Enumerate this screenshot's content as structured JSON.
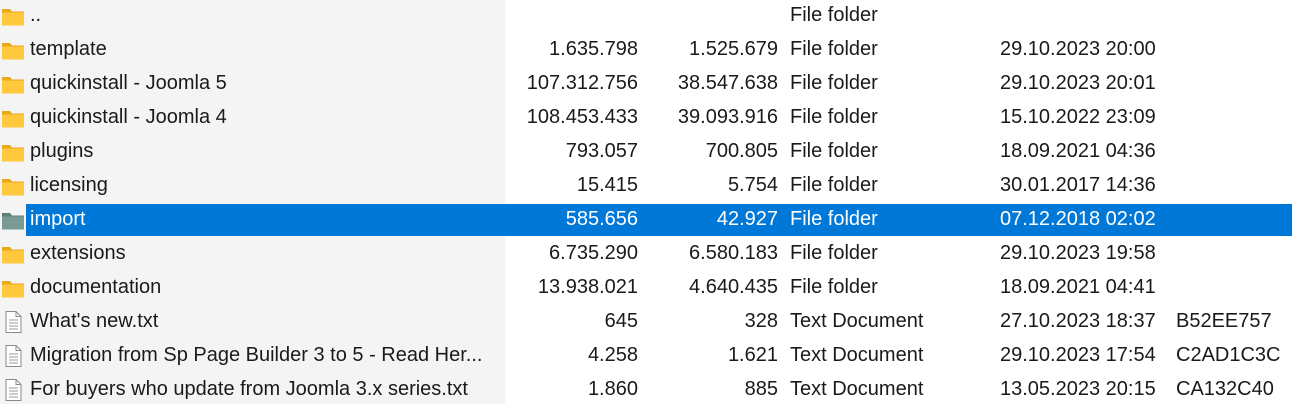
{
  "file_list": {
    "rows": [
      {
        "name": "..",
        "size": "",
        "packed": "",
        "type": "File folder",
        "modified": "",
        "crc": "",
        "icon": "folder-icon",
        "selected": false
      },
      {
        "name": "template",
        "size": "1.635.798",
        "packed": "1.525.679",
        "type": "File folder",
        "modified": "29.10.2023 20:00",
        "crc": "",
        "icon": "folder-icon",
        "selected": false
      },
      {
        "name": "quickinstall - Joomla 5",
        "size": "107.312.756",
        "packed": "38.547.638",
        "type": "File folder",
        "modified": "29.10.2023 20:01",
        "crc": "",
        "icon": "folder-icon",
        "selected": false
      },
      {
        "name": "quickinstall - Joomla 4",
        "size": "108.453.433",
        "packed": "39.093.916",
        "type": "File folder",
        "modified": "15.10.2022 23:09",
        "crc": "",
        "icon": "folder-icon",
        "selected": false
      },
      {
        "name": "plugins",
        "size": "793.057",
        "packed": "700.805",
        "type": "File folder",
        "modified": "18.09.2021 04:36",
        "crc": "",
        "icon": "folder-icon",
        "selected": false
      },
      {
        "name": "licensing",
        "size": "15.415",
        "packed": "5.754",
        "type": "File folder",
        "modified": "30.01.2017 14:36",
        "crc": "",
        "icon": "folder-icon",
        "selected": false
      },
      {
        "name": "import",
        "size": "585.656",
        "packed": "42.927",
        "type": "File folder",
        "modified": "07.12.2018 02:02",
        "crc": "",
        "icon": "folder-icon",
        "selected": true
      },
      {
        "name": "extensions",
        "size": "6.735.290",
        "packed": "6.580.183",
        "type": "File folder",
        "modified": "29.10.2023 19:58",
        "crc": "",
        "icon": "folder-icon",
        "selected": false
      },
      {
        "name": "documentation",
        "size": "13.938.021",
        "packed": "4.640.435",
        "type": "File folder",
        "modified": "18.09.2021 04:41",
        "crc": "",
        "icon": "folder-icon",
        "selected": false
      },
      {
        "name": "What's new.txt",
        "size": "645",
        "packed": "328",
        "type": "Text Document",
        "modified": "27.10.2023 18:37",
        "crc": "B52EE757",
        "icon": "text-file-icon",
        "selected": false
      },
      {
        "name": "Migration from Sp Page Builder 3 to 5 - Read Her...",
        "size": "4.258",
        "packed": "1.621",
        "type": "Text Document",
        "modified": "29.10.2023 17:54",
        "crc": "C2AD1C3C",
        "icon": "text-file-icon",
        "selected": false
      },
      {
        "name": "For buyers who update from Joomla 3.x series.txt",
        "size": "1.860",
        "packed": "885",
        "type": "Text Document",
        "modified": "13.05.2023 20:15",
        "crc": "CA132C40",
        "icon": "text-file-icon",
        "selected": false
      }
    ]
  },
  "colors": {
    "selection": "#0078d7",
    "folder": "#ffc83d",
    "folder_selected": "#7a9a96",
    "name_column_shade": "#f4f4f4"
  }
}
